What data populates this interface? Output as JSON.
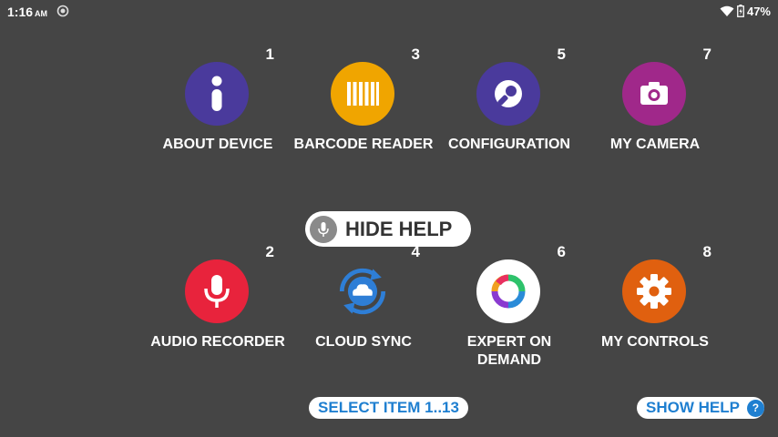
{
  "status_bar": {
    "time": "1:16",
    "ampm": "AM",
    "battery_percent": "47%",
    "icons": [
      "sync-icon",
      "wifi-icon",
      "battery-charging-icon"
    ]
  },
  "items": [
    {
      "number": "1",
      "label": "ABOUT DEVICE",
      "color": "#4a3a9c",
      "icon": "info-icon"
    },
    {
      "number": "3",
      "label": "BARCODE READER",
      "color": "#f0a500",
      "icon": "barcode-icon"
    },
    {
      "number": "5",
      "label": "CONFIGURATION",
      "color": "#4a3a9c",
      "icon": "wrench-icon"
    },
    {
      "number": "7",
      "label": "MY CAMERA",
      "color": "#a0288a",
      "icon": "camera-icon"
    },
    {
      "number": "2",
      "label": "AUDIO RECORDER",
      "color": "#e8233c",
      "icon": "microphone-icon"
    },
    {
      "number": "4",
      "label": "CLOUD SYNC",
      "color": "#2e7ed6",
      "icon": "cloud-sync-icon"
    },
    {
      "number": "6",
      "label": "EXPERT ON DEMAND",
      "color": "#ffffff",
      "icon": "expert-ring-icon"
    },
    {
      "number": "8",
      "label": "MY CONTROLS",
      "color": "#e0600f",
      "icon": "gear-icon"
    }
  ],
  "hide_help": {
    "label": "HIDE HELP",
    "icon": "microphone-icon"
  },
  "select_item": {
    "label": "SELECT ITEM 1..13"
  },
  "show_help": {
    "label": "SHOW HELP",
    "badge": "?"
  }
}
